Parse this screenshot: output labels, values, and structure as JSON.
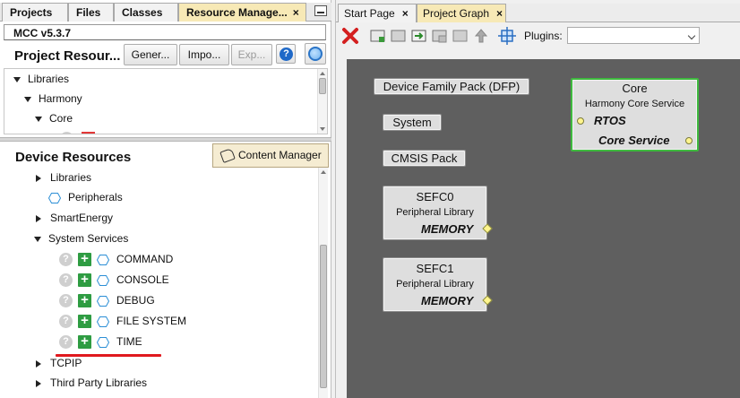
{
  "left_tabs": [
    {
      "label": "Projects"
    },
    {
      "label": "Files"
    },
    {
      "label": "Classes"
    },
    {
      "label": "Resource Manage...",
      "close": "×"
    }
  ],
  "mcc_version": "MCC v5.3.7",
  "project_resources": {
    "title": "Project Resour...",
    "buttons": {
      "generate": "Gener...",
      "import": "Impo...",
      "export": "Exp..."
    },
    "help": "?",
    "tree": [
      {
        "label": "Libraries",
        "expanded": true
      },
      {
        "label": "Harmony",
        "expanded": true
      },
      {
        "label": "Core",
        "expanded": true
      }
    ]
  },
  "device_resources": {
    "title": "Device Resources",
    "content_manager": "Content Manager",
    "tree": {
      "libraries": "Libraries",
      "peripherals": "Peripherals",
      "smart_energy": "SmartEnergy",
      "system_services": "System Services",
      "services": [
        "COMMAND",
        "CONSOLE",
        "DEBUG",
        "FILE SYSTEM",
        "TIME"
      ],
      "tcpip": "TCPIP",
      "third_party": "Third Party Libraries"
    }
  },
  "right_tabs": [
    {
      "label": "Start Page",
      "close": "×"
    },
    {
      "label": "Project Graph",
      "close": "×"
    }
  ],
  "toolbar": {
    "plugins_label": "Plugins:",
    "plugins_value": ""
  },
  "graph": {
    "dfp": "Device Family Pack (DFP)",
    "system": "System",
    "cmsis": "CMSIS Pack",
    "sefc0": {
      "title": "SEFC0",
      "subtitle": "Peripheral Library",
      "port": "MEMORY"
    },
    "sefc1": {
      "title": "SEFC1",
      "subtitle": "Peripheral Library",
      "port": "MEMORY"
    },
    "core": {
      "title": "Core",
      "subtitle": "Harmony Core Service",
      "port_in": "RTOS",
      "port_out": "Core Service"
    }
  },
  "colors": {
    "accent_tab": "#f7e9b6",
    "canvas": "#5f5f5f",
    "core_border": "#3fba3f",
    "highlight": "#e0191e",
    "add_green": "#2e9c42"
  }
}
